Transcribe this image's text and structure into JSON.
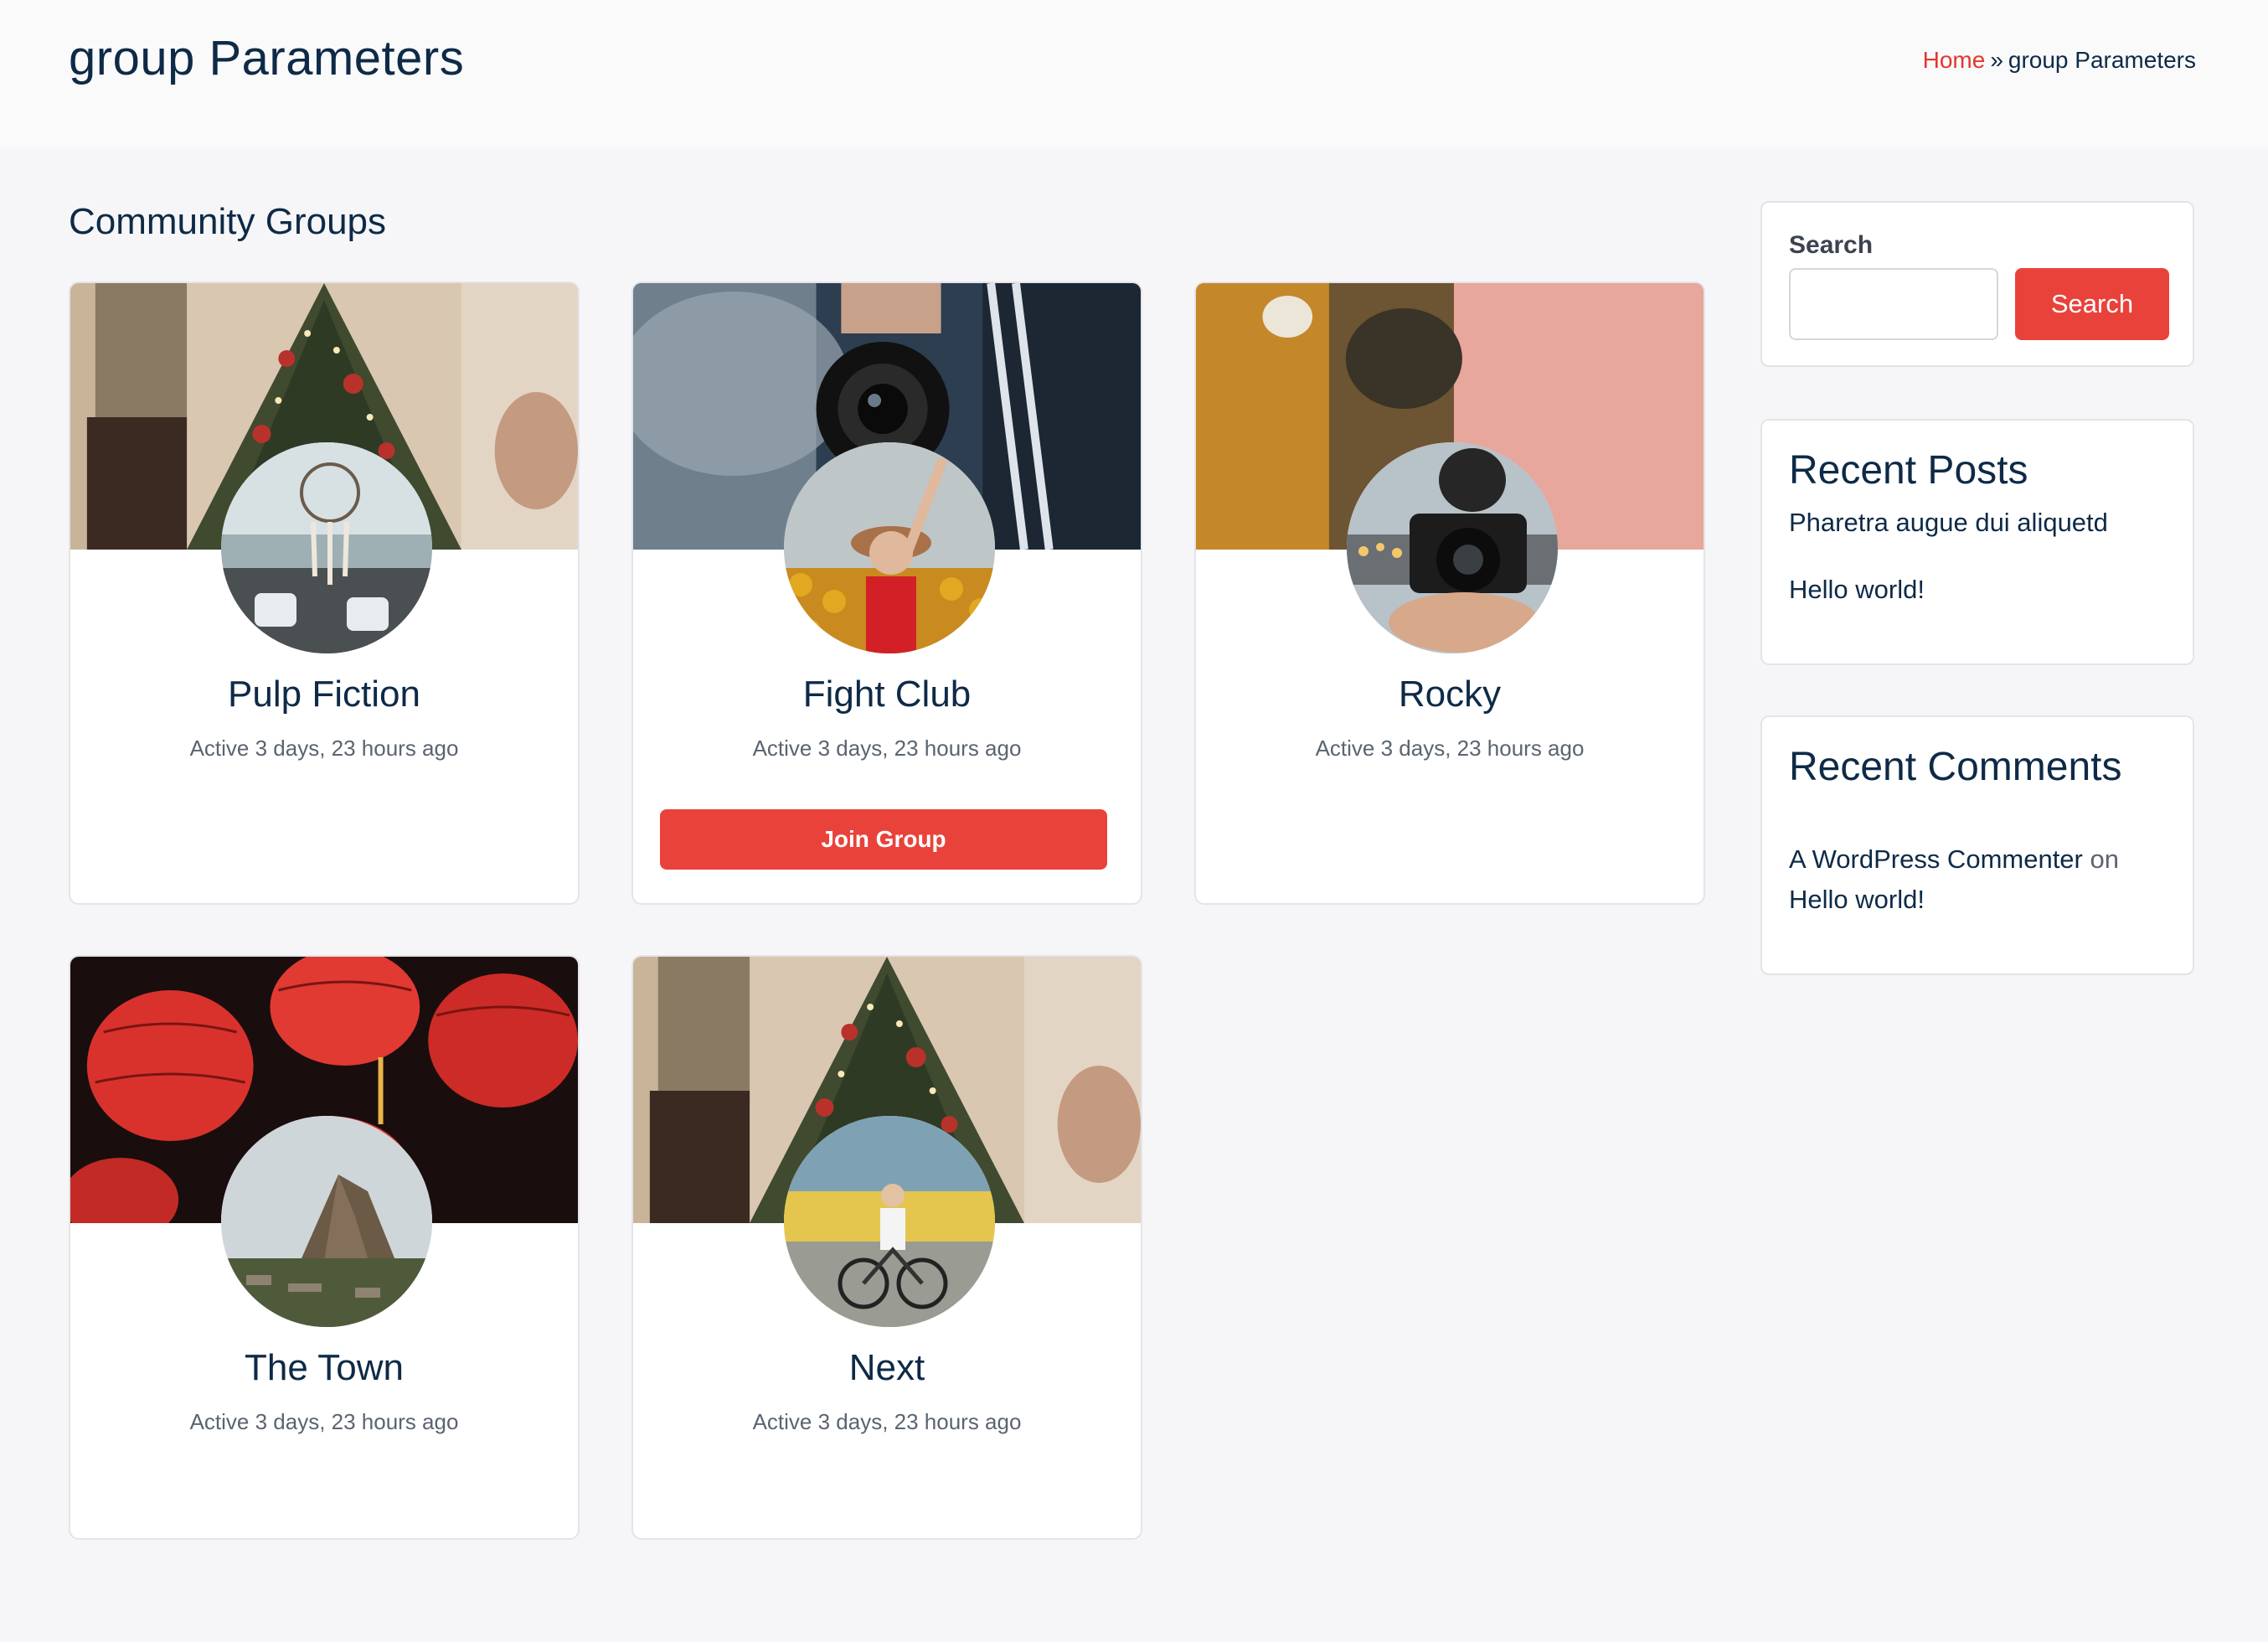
{
  "header": {
    "title": "group Parameters",
    "breadcrumb": {
      "home": "Home",
      "separator": "»",
      "current": "group Parameters"
    }
  },
  "main": {
    "section_title": "Community Groups",
    "groups": [
      {
        "name": "Pulp Fiction",
        "activity": "Active 3 days, 23 hours ago",
        "cover": "christmas-tree-photo",
        "avatar": "car-dreamcatcher-photo"
      },
      {
        "name": "Fight Club",
        "activity": "Active 3 days, 23 hours ago",
        "cover": "camera-lens-photo",
        "avatar": "sunflower-woman-photo",
        "join_label": "Join Group"
      },
      {
        "name": "Rocky",
        "activity": "Active 3 days, 23 hours ago",
        "cover": "blurred-orange-photo",
        "avatar": "hand-camera-photo"
      },
      {
        "name": "The Town",
        "activity": "Active 3 days, 23 hours ago",
        "cover": "red-lanterns-photo",
        "avatar": "mountain-ruins-photo"
      },
      {
        "name": "Next",
        "activity": "Active 3 days, 23 hours ago",
        "cover": "christmas-tree-photo",
        "avatar": "cyclists-photo"
      }
    ]
  },
  "sidebar": {
    "search": {
      "label": "Search",
      "placeholder": "",
      "value": "",
      "button_label": "Search"
    },
    "recent_posts": {
      "title": "Recent Posts",
      "items": [
        "Pharetra augue dui aliquetd",
        "Hello world!"
      ]
    },
    "recent_comments": {
      "title": "Recent Comments",
      "author": "A WordPress Commenter",
      "connector": "on",
      "post": "Hello world!"
    }
  },
  "colors": {
    "accent": "#e9423a",
    "link_red": "#e2372c",
    "heading": "#0e2a47",
    "muted": "#5b6470",
    "background": "#f6f6f8"
  }
}
